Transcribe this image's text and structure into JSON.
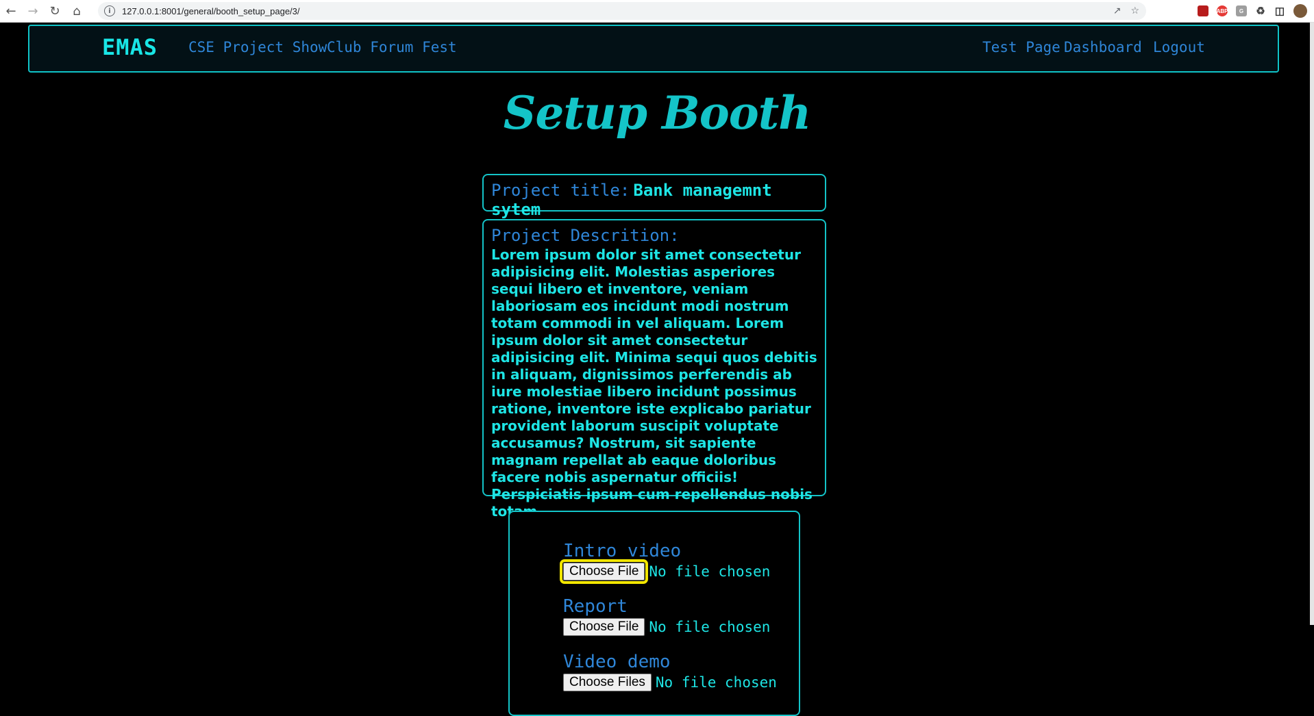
{
  "browser": {
    "url": "127.0.0.1:8001/general/booth_setup_page/3/",
    "nav_icons": [
      "back-arrow-icon",
      "forward-arrow-icon",
      "reload-icon",
      "home-icon"
    ],
    "extensions": [
      "ublock-icon",
      "adblock-plus-icon",
      "grammarly-icon",
      "extensions-puzzle-icon",
      "side-panel-icon",
      "profile-avatar"
    ],
    "ext_labels": {
      "ublock": "",
      "abp": "ABP",
      "g": "G"
    }
  },
  "navbar": {
    "brand": "EMAS",
    "left_links": [
      "CSE Project Show",
      "Club Forum Fest"
    ],
    "right_links": [
      "Test Page",
      "Dashboard",
      "Logout"
    ]
  },
  "page": {
    "title": "Setup Booth"
  },
  "project": {
    "title_label": "Project title:",
    "title_value": "Bank managemnt sytem",
    "description_label": "Project Descrition:",
    "description_text": "Lorem ipsum dolor sit amet consectetur adipisicing elit. Molestias asperiores sequi libero et inventore, veniam laboriosam eos incidunt modi nostrum totam commodi in vel aliquam. Lorem ipsum dolor sit amet consectetur adipisicing elit. Minima sequi quos debitis in aliquam, dignissimos perferendis ab iure molestiae libero incidunt possimus ratione, inventore iste explicabo pariatur provident laborum suscipit voluptate accusamus? Nostrum, sit sapiente magnam repellat ab eaque doloribus facere nobis aspernatur officiis! Perspiciatis ipsum cum repellendus nobis totam."
  },
  "uploads": [
    {
      "label": "Intro video",
      "button": "Choose File",
      "status": "No file chosen"
    },
    {
      "label": "Report",
      "button": "Choose File",
      "status": "No file chosen"
    },
    {
      "label": "Video demo",
      "button": "Choose Files",
      "status": "No file chosen"
    }
  ],
  "colors": {
    "accent_cyan": "#14c4c8",
    "link_blue": "#2f86d8",
    "text_cyan": "#1ee5e5",
    "focus_yellow": "#f2e600"
  }
}
